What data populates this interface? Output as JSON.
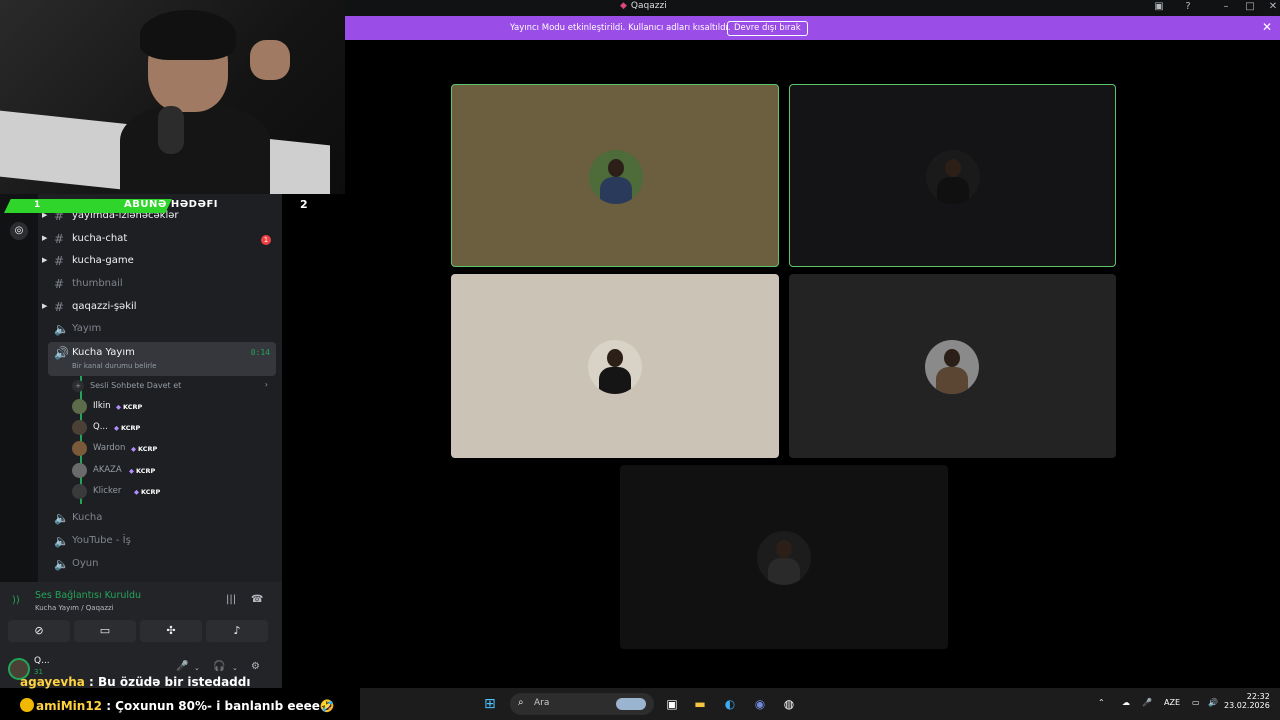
{
  "window": {
    "title": "Qaqazzi",
    "controls": [
      "inbox-icon",
      "help-icon",
      "minimize-icon",
      "maximize-icon",
      "close-icon"
    ]
  },
  "banner": {
    "message": "Yayıncı Modu etkinleştirildi. Kullanıcı adları kısaltıldı.",
    "button": "Devre dışı bırak",
    "color": "#9b4de8"
  },
  "goal": {
    "start": "1",
    "label": "ABUNƏ HƏDƏFI",
    "end": "2",
    "progress_fraction": 0.6,
    "color": "#2fd52b"
  },
  "channels": [
    {
      "name": "yayımda-izlənəcəklər",
      "type": "text",
      "caret": true,
      "state": "bright"
    },
    {
      "name": "kucha-chat",
      "type": "text",
      "caret": true,
      "state": "bright",
      "badge": "1"
    },
    {
      "name": "kucha-game",
      "type": "text",
      "caret": true,
      "state": "bright"
    },
    {
      "name": "thumbnail",
      "type": "text",
      "caret": false,
      "state": "dim"
    },
    {
      "name": "qaqazzi-şəkil",
      "type": "text",
      "caret": true,
      "state": "bright"
    },
    {
      "name": "Yayım",
      "type": "voice",
      "caret": false,
      "state": "dim"
    }
  ],
  "active_voice": {
    "name": "Kucha Yayım",
    "status": "Bir kanal durumu belirle",
    "time": "0:14",
    "invite": "Sesli Sohbete Davet et",
    "members": [
      {
        "name": "Ilkin",
        "tag": "KCRP",
        "avatar_color": "#5c6b4a"
      },
      {
        "name": "Q...",
        "tag": "KCRP",
        "avatar_color": "#4a4036"
      },
      {
        "name": "Wardon",
        "tag": "KCRP",
        "avatar_color": "#7a5a3a"
      },
      {
        "name": "AKAZA",
        "tag": "KCRP",
        "avatar_color": "#6a6a6a"
      },
      {
        "name": "Klicker",
        "tag": "KCRP",
        "avatar_color": "#3a3a3a"
      }
    ]
  },
  "voice_channels_below": [
    "Kucha",
    "YouTube - İş",
    "Oyun"
  ],
  "voice_panel": {
    "title": "Ses Bağlantısı Kuruldu",
    "subtitle": "Kucha Yayım / Qaqazzi",
    "actions": [
      "camera-off-icon",
      "screen-share-icon",
      "activities-icon",
      "soundboard-icon"
    ]
  },
  "user_panel": {
    "name": "Q...",
    "bits": "31"
  },
  "grid": {
    "tiles": [
      {
        "bg": "#6b5f40",
        "speaking": true,
        "avatar_bg": "#4e6b3a",
        "avatar_body": "#2a3a5a"
      },
      {
        "bg": "#141416",
        "speaking": true,
        "avatar_bg": "#1a1a1a",
        "avatar_body": "#101010"
      },
      {
        "bg": "#cbc3b5",
        "speaking": false,
        "avatar_bg": "#d9d2c6",
        "avatar_body": "#151515"
      },
      {
        "bg": "#232323",
        "speaking": false,
        "avatar_bg": "#8a8a8a",
        "avatar_body": "#5a4632"
      },
      {
        "bg": "#111111",
        "speaking": false,
        "avatar_bg": "#1c1c1c",
        "avatar_body": "#2a2a2a"
      }
    ]
  },
  "chat": [
    {
      "user": "agayevha",
      "message": " : Bu özüdə bir istedaddı"
    },
    {
      "user": "amiMin12",
      "message": " : Çoxunun 80%- i banlanıb eeee🤣"
    }
  ],
  "taskbar": {
    "search_label": "Ara",
    "lang": "AZE",
    "time": "22:32",
    "date": "23.02.2026",
    "apps": [
      "task-view-icon",
      "file-explorer-icon",
      "edge-icon",
      "discord-icon",
      "obs-icon"
    ]
  }
}
